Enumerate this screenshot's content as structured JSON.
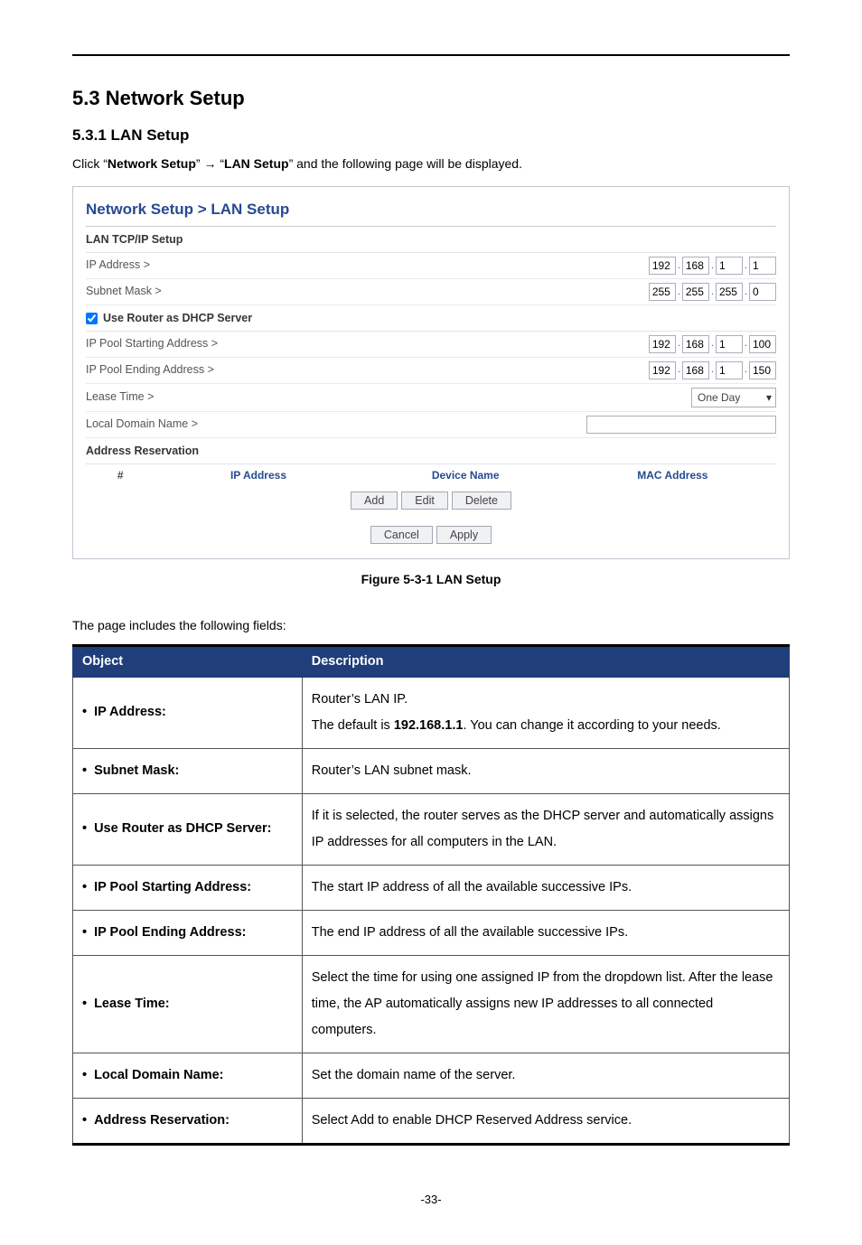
{
  "doc": {
    "section_heading": "5.3  Network Setup",
    "subsection_heading": "5.3.1  LAN Setup",
    "intro_prefix": "Click “",
    "intro_bold1": "Network Setup",
    "intro_mid": "” → “",
    "intro_bold2": "LAN Setup",
    "intro_suffix": "” and the following page will be displayed.",
    "figure_caption": "Figure 5-3-1 LAN Setup",
    "fields_intro": "The page includes the following fields:",
    "page_number": "-33-"
  },
  "ui": {
    "title": "Network Setup > LAN Setup",
    "group_lan": "LAN TCP/IP Setup",
    "ip_label": "IP Address >",
    "ip_octets": [
      "192",
      "168",
      "1",
      "1"
    ],
    "subnet_label": "Subnet Mask >",
    "subnet_octets": [
      "255",
      "255",
      "255",
      "0"
    ],
    "use_router_label": "Use Router as DHCP Server",
    "pool_start_label": "IP Pool Starting Address >",
    "pool_start_octets": [
      "192",
      "168",
      "1",
      "100"
    ],
    "pool_end_label": "IP Pool Ending Address >",
    "pool_end_octets": [
      "192",
      "168",
      "1",
      "150"
    ],
    "lease_label": "Lease Time >",
    "lease_value": "One Day",
    "local_domain_label": "Local Domain Name >",
    "group_reservation": "Address Reservation",
    "col_num": "#",
    "col_ip": "IP Address",
    "col_dev": "Device Name",
    "col_mac": "MAC Address",
    "btn_add": "Add",
    "btn_edit": "Edit",
    "btn_delete": "Delete",
    "btn_cancel": "Cancel",
    "btn_apply": "Apply"
  },
  "table": {
    "h_object": "Object",
    "h_desc": "Description",
    "rows": [
      {
        "obj": "IP Address:",
        "desc_pre": "Router’s LAN IP.",
        "desc_mid1": "The default is ",
        "desc_bold": "192.168.1.1",
        "desc_mid2": ". You can change it according to your needs."
      },
      {
        "obj": "Subnet Mask:",
        "desc": "Router’s LAN subnet mask."
      },
      {
        "obj": "Use Router as DHCP Server:",
        "desc": "If it is selected, the router serves as the DHCP server and automatically assigns IP addresses for all computers in the LAN."
      },
      {
        "obj": "IP Pool Starting Address:",
        "desc": "The start IP address of all the available successive IPs."
      },
      {
        "obj": "IP Pool Ending Address:",
        "desc": "The end IP address of all the available successive IPs."
      },
      {
        "obj": "Lease Time:",
        "desc": "Select the time for using one assigned IP from the dropdown list. After the lease time, the AP automatically assigns new IP addresses to all connected computers."
      },
      {
        "obj": "Local Domain Name:",
        "desc": "Set the domain name of the server."
      },
      {
        "obj": "Address Reservation:",
        "desc": "Select Add to enable DHCP Reserved Address service."
      }
    ]
  }
}
